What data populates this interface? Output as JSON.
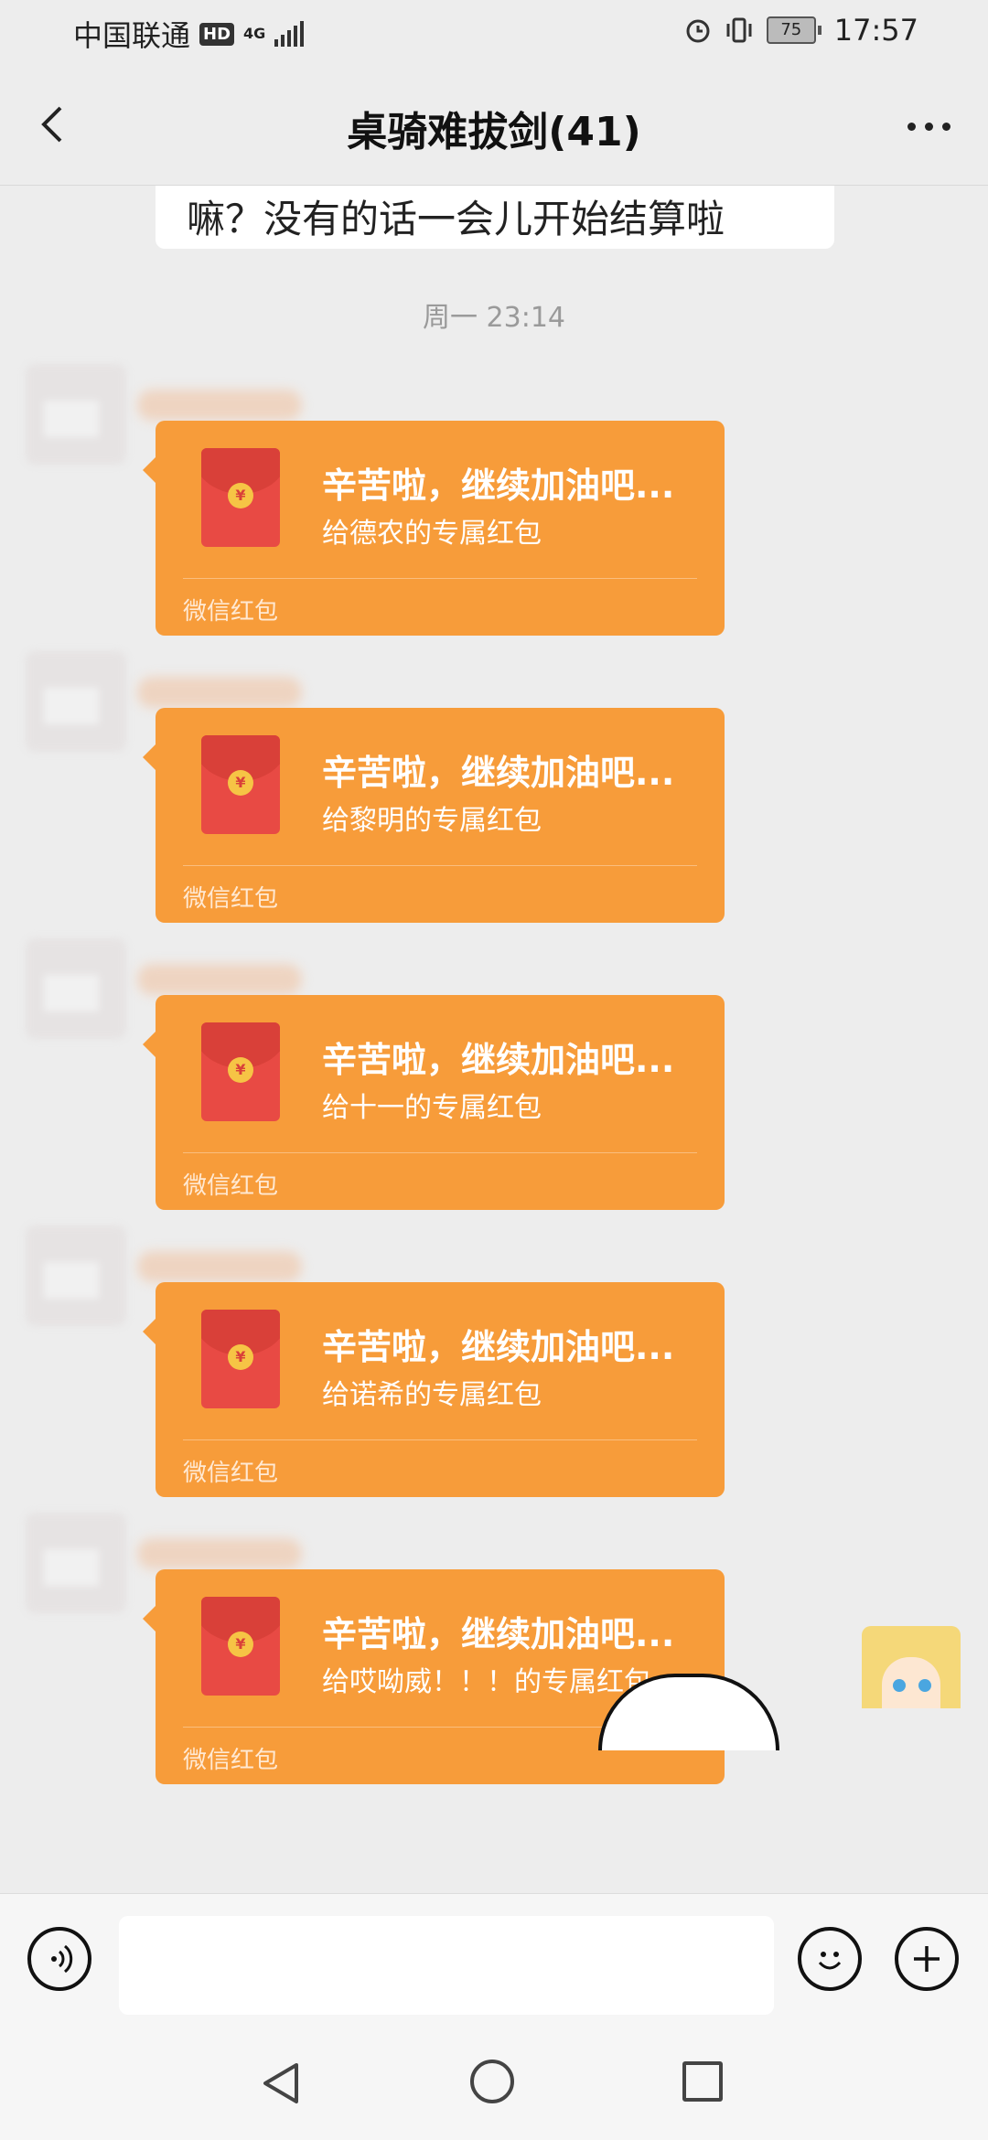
{
  "status_bar": {
    "carrier": "中国联通",
    "hd_badge": "HD",
    "network": "4G",
    "battery": "75",
    "time": "17:57"
  },
  "header": {
    "title": "桌骑难拔剑(41)",
    "back_icon": "chevron-left-icon",
    "more_icon": "more-dots-icon"
  },
  "chat": {
    "partial_text": "嘛？没有的话一会儿开始结算啦",
    "timestamp": "周一 23:14",
    "red_packets": [
      {
        "title": "辛苦啦，继续加油吧...",
        "subtitle": "给德农的专属红包",
        "footer": "微信红包"
      },
      {
        "title": "辛苦啦，继续加油吧...",
        "subtitle": "给黎明的专属红包",
        "footer": "微信红包"
      },
      {
        "title": "辛苦啦，继续加油吧...",
        "subtitle": "给十一的专属红包",
        "footer": "微信红包"
      },
      {
        "title": "辛苦啦，继续加油吧...",
        "subtitle": "给诺希的专属红包",
        "footer": "微信红包"
      },
      {
        "title": "辛苦啦，继续加油吧...",
        "subtitle": "给哎呦威！！！的专属红包",
        "footer": "微信红包"
      }
    ]
  },
  "input_bar": {
    "voice_icon": "voice-icon",
    "emoji_icon": "emoji-icon",
    "plus_icon": "plus-icon",
    "text_value": ""
  },
  "nav_bar": {
    "back_icon": "nav-back-icon",
    "home_icon": "nav-home-icon",
    "recent_icon": "nav-recent-icon"
  },
  "colors": {
    "red_packet": "#f79c3a",
    "envelope": "#e84a44",
    "background": "#ededed"
  }
}
